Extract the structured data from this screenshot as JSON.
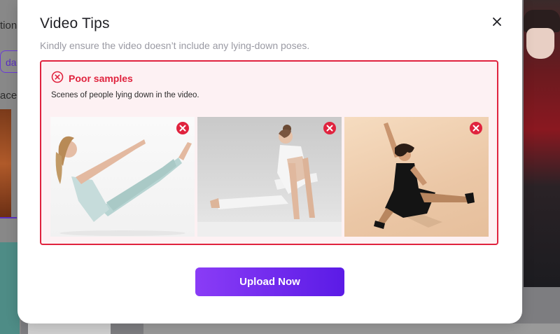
{
  "background": {
    "text_1": "tion",
    "chip_label": "da",
    "text_2": "ace"
  },
  "modal": {
    "title": "Video Tips",
    "subtitle": "Kindly ensure the video doesn’t include any lying-down poses.",
    "close_icon": "close-icon"
  },
  "poor_samples": {
    "title": "Poor samples",
    "description": "Scenes of people lying down in the video.",
    "icon": "error-circle-icon",
    "accent_color": "#e0233e",
    "images": [
      {
        "alt": "Woman in light blue activewear doing a V-sit pose"
      },
      {
        "alt": "Woman in white doing an arm-balance pose"
      },
      {
        "alt": "Dancer in black dress leaping"
      }
    ]
  },
  "actions": {
    "upload_label": "Upload Now"
  }
}
